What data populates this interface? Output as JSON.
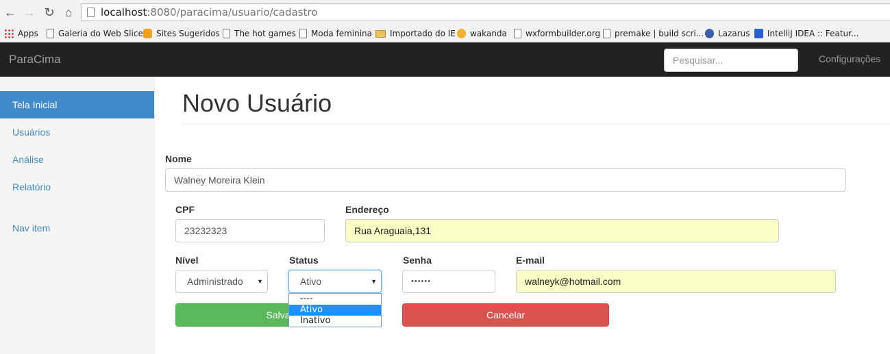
{
  "browser": {
    "url_host": "localhost",
    "url_path": ":8080/paracima/usuario/cadastro",
    "bookmarks": [
      {
        "label": "Apps",
        "icon": "apps-grid-icon"
      },
      {
        "label": "Galeria do Web Slice",
        "icon": "page-icon"
      },
      {
        "label": "Sites Sugeridos",
        "icon": "suggested-sites-icon"
      },
      {
        "label": "The hot games",
        "icon": "page-icon"
      },
      {
        "label": "Moda feminina",
        "icon": "page-icon"
      },
      {
        "label": "Importado do IE",
        "icon": "folder-icon"
      },
      {
        "label": "wakanda",
        "icon": "wakanda-icon"
      },
      {
        "label": "wxformbuilder.org",
        "icon": "page-icon"
      },
      {
        "label": "premake | build scri...",
        "icon": "page-icon"
      },
      {
        "label": "Lazarus",
        "icon": "lazarus-icon"
      },
      {
        "label": "IntelliJ IDEA :: Featur...",
        "icon": "intellij-icon"
      }
    ]
  },
  "navbar": {
    "brand": "ParaCima",
    "search_placeholder": "Pesquisar...",
    "config_link": "Configurações"
  },
  "sidebar": {
    "items": [
      {
        "label": "Tela Inicial",
        "active": true
      },
      {
        "label": "Usuários",
        "active": false
      },
      {
        "label": "Análise",
        "active": false
      },
      {
        "label": "Relatório",
        "active": false
      },
      {
        "label": "Nav item",
        "active": false
      }
    ]
  },
  "main": {
    "title": "Novo Usuário",
    "form": {
      "nome": {
        "label": "Nome",
        "value": "Walney Moreira Klein"
      },
      "cpf": {
        "label": "CPF",
        "value": "23232323"
      },
      "endereco": {
        "label": "Endereço",
        "value": "Rua Araguaia,131"
      },
      "nivel": {
        "label": "Nível",
        "value": "Administrado"
      },
      "status": {
        "label": "Status",
        "value": "Ativo",
        "options": [
          "----",
          "Ativo",
          "Inativo"
        ],
        "highlighted_option": "Ativo"
      },
      "senha": {
        "label": "Senha",
        "value": "••••••"
      },
      "email": {
        "label": "E-mail",
        "value": "walneyk@hotmail.com"
      }
    },
    "buttons": {
      "save": "Salva",
      "cancel": "Cancelar"
    }
  },
  "colors": {
    "navbar_bg": "#222222",
    "sidebar_active": "#428bca",
    "save_button": "#5cb85c",
    "cancel_button": "#d9534f",
    "autofill_yellow": "#fafdc4",
    "dropdown_highlight": "#1e90ff"
  }
}
